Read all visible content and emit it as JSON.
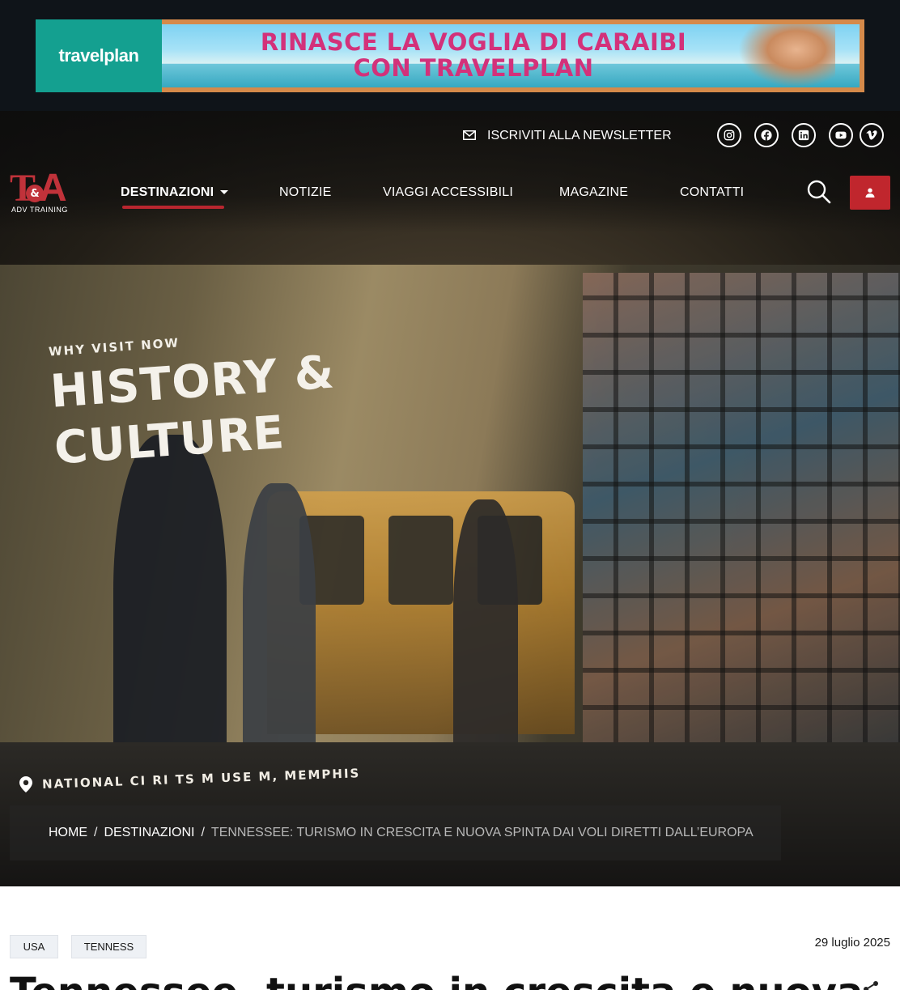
{
  "ad": {
    "brand": "travelplan",
    "headline_line1": "RINASCE LA VOGLIA DI CARAIBI",
    "headline_line2": "CON TRAVELPLAN"
  },
  "topbar": {
    "newsletter_label": "ISCRIVITI ALLA NEWSLETTER",
    "social": [
      "instagram-icon",
      "facebook-icon",
      "linkedin-icon",
      "youtube-icon",
      "vimeo-icon"
    ]
  },
  "logo": {
    "letter_left": "T",
    "ampersand": "&",
    "letter_right": "A",
    "subtitle": "ADV TRAINING"
  },
  "nav": {
    "items": [
      {
        "label": "DESTINAZIONI",
        "active": true
      },
      {
        "label": "NOTIZIE"
      },
      {
        "label": "VIAGGI ACCESSIBILI"
      },
      {
        "label": "MAGAZINE"
      },
      {
        "label": "CONTATTI"
      }
    ]
  },
  "hero": {
    "kicker": "WHY VISIT NOW",
    "headline_line1": "HISTORY &",
    "headline_line2": "CULTURE",
    "location": "NATIONAL CI  RI  TS  M USE  M, MEMPHIS"
  },
  "breadcrumb": {
    "home": "HOME",
    "section": "DESTINAZIONI",
    "current": "TENNESSEE: TURISMO IN CRESCITA E NUOVA SPINTA DAI VOLI DIRETTI DALL’EUROPA"
  },
  "article": {
    "tags": [
      "USA",
      "TENNESS"
    ],
    "date": "29 luglio 2025",
    "title_visible": "Tennessee, turismo in crescita e nuova"
  },
  "colors": {
    "accent_red": "#c0262d",
    "ad_teal": "#14a090",
    "ad_pink": "#d3317a"
  }
}
